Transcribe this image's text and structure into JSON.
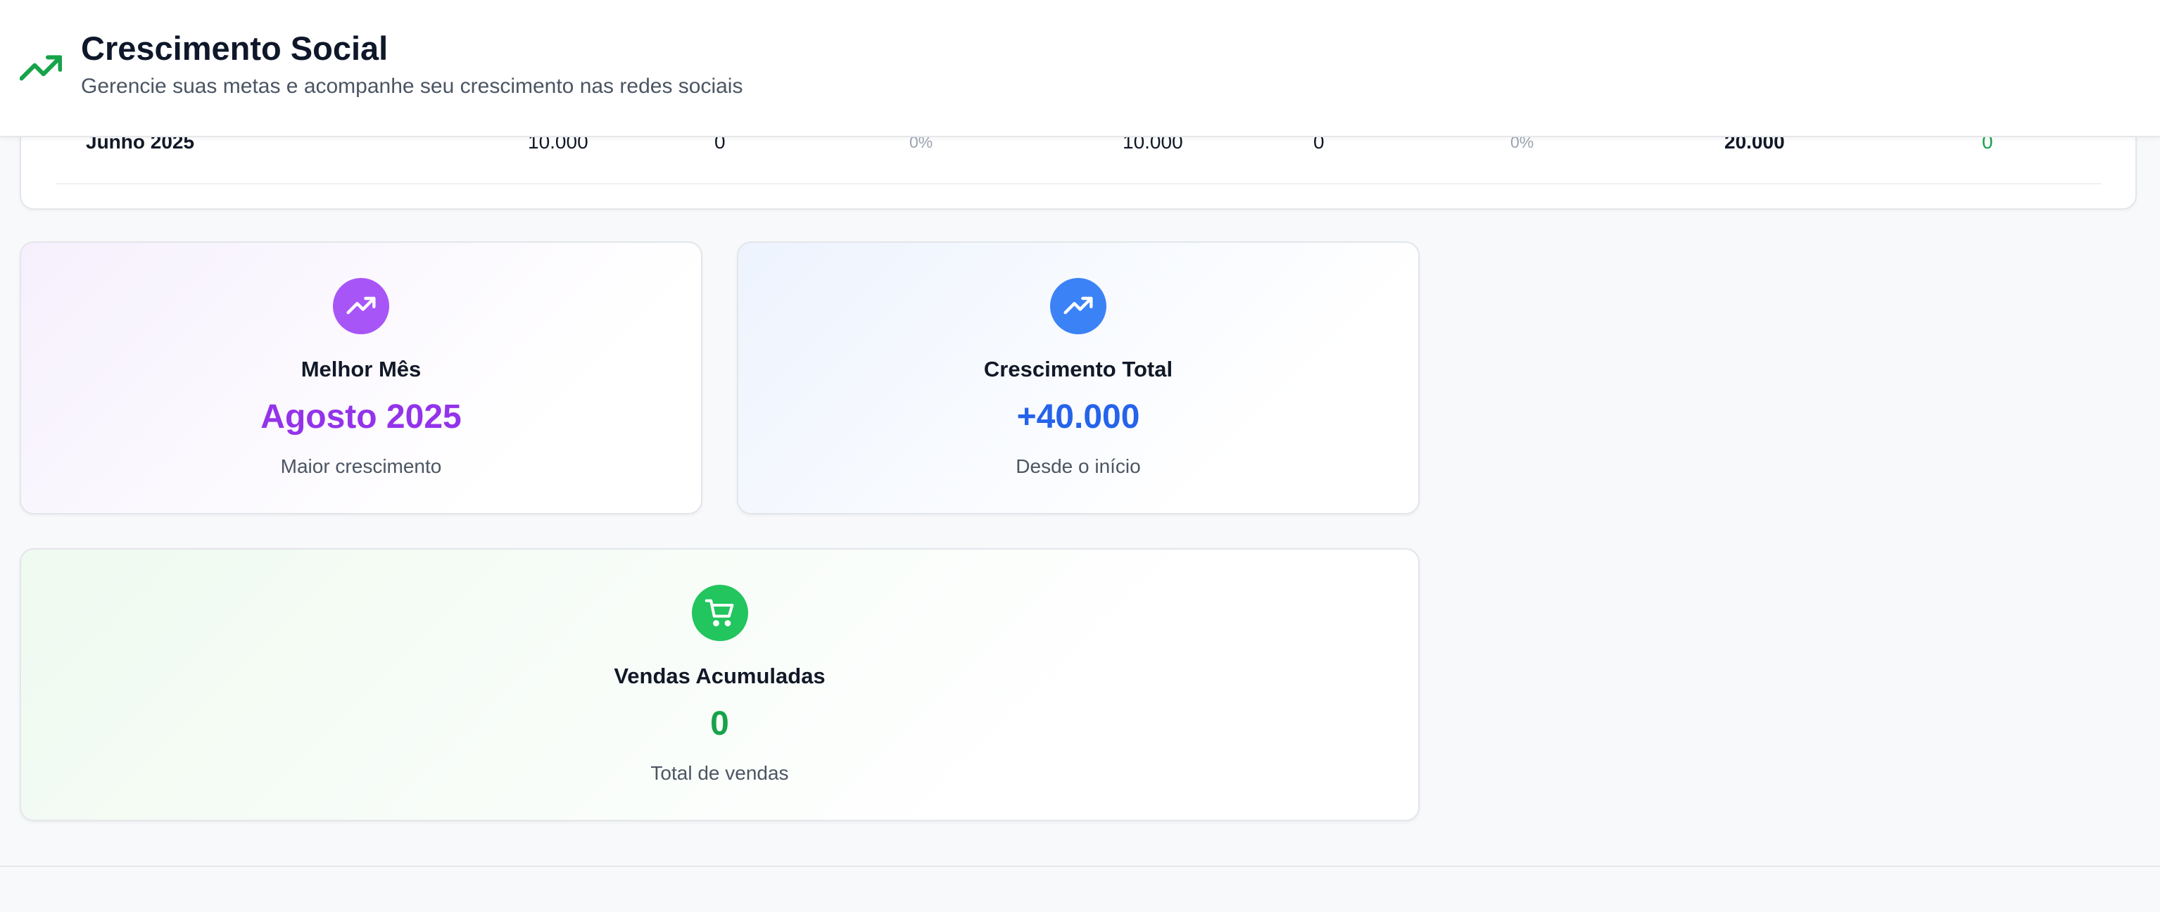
{
  "header": {
    "title": "Crescimento Social",
    "subtitle": "Gerencie suas metas e acompanhe seu crescimento nas redes sociais",
    "icon": "trending-up-icon",
    "icon_color": "#16a34a"
  },
  "table": {
    "row": {
      "month": "Junho 2025",
      "col1": "10.000",
      "col2": "0",
      "col3": "0%",
      "col4": "10.000",
      "col5": "0",
      "col6": "0%",
      "total": "20.000",
      "growth": "0"
    }
  },
  "cards": {
    "best_month": {
      "title": "Melhor Mês",
      "value": "Agosto 2025",
      "note": "Maior crescimento",
      "icon": "trending-up-icon",
      "color": "#a855f7"
    },
    "total_growth": {
      "title": "Crescimento Total",
      "value": "+40.000",
      "note": "Desde o início",
      "icon": "trending-up-icon",
      "color": "#3b82f6"
    },
    "sales": {
      "title": "Vendas Acumuladas",
      "value": "0",
      "note": "Total de vendas",
      "icon": "shopping-cart-icon",
      "color": "#22c55e"
    }
  }
}
